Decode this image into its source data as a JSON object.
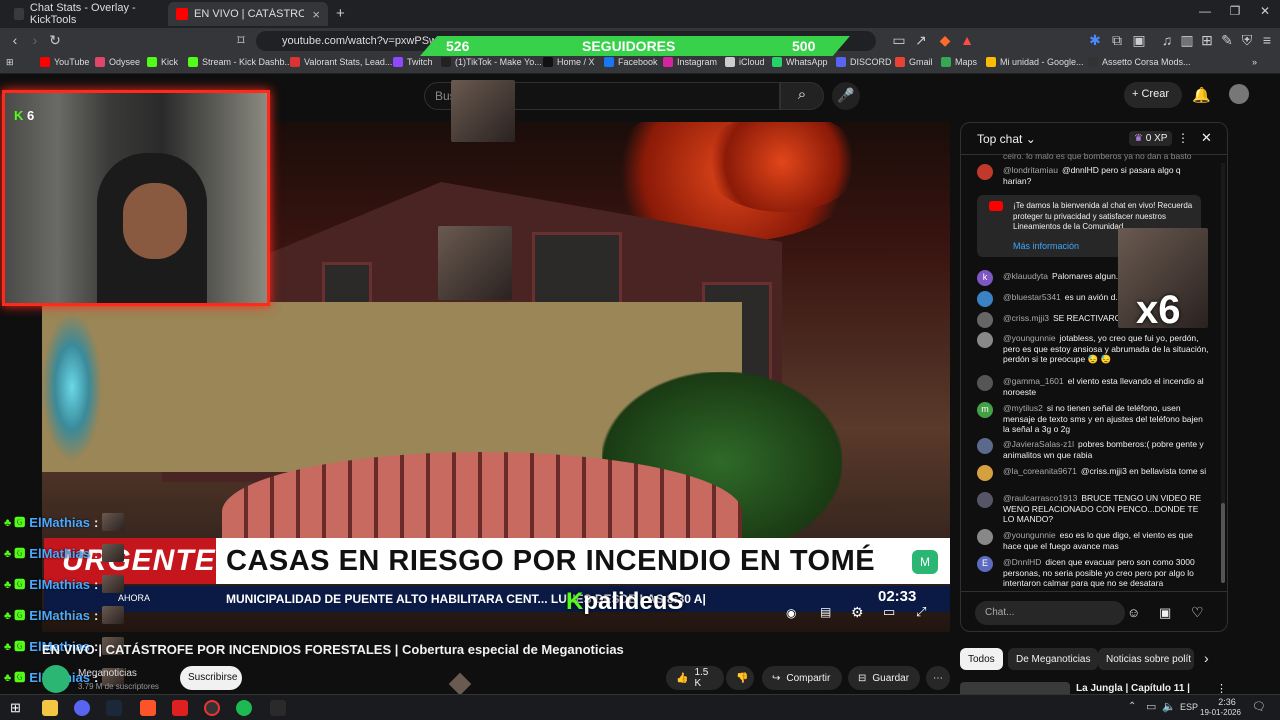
{
  "browser": {
    "tabs": [
      {
        "label": "Chat Stats - Overlay - KickTools"
      },
      {
        "label": "EN VIVO | CATÁSTROFE POR I"
      }
    ],
    "url": "youtube.com/watch?v=pxwPSwTv-10",
    "bookmarks": [
      "YouTube",
      "Odysee",
      "Kick",
      "Stream - Kick Dashb...",
      "Valorant Stats, Lead...",
      "Twitch",
      "(1)TikTok - Make Yo...",
      "Home / X",
      "Facebook",
      "Instagram",
      "iCloud",
      "WhatsApp",
      "DISCORD",
      "Gmail",
      "Maps",
      "Mi unidad - Google...",
      "Assetto Corsa Mods..."
    ]
  },
  "overlay": {
    "followers_current": "526",
    "followers_label": "SEGUIDORES",
    "followers_goal": "500",
    "webcam_badge": "6",
    "chat_user": "ElMathias",
    "chat_sep": ":",
    "x6": "x6",
    "kick_user": "palideuS"
  },
  "youtube": {
    "search_placeholder": "Busca",
    "create_label": "Crear",
    "news": {
      "urgente": "URGENTE",
      "headline": "CASAS EN RIESGO POR INCENDIO EN TOMÉ",
      "ticker": "MUNICIPALIDAD DE PUENTE ALTO HABILITARA CENT... LUNES DESDE LAS 8:30 A|",
      "ahora": "AHORA",
      "clock": "02:33"
    },
    "video_title": "EN VIVO | CATÁSTROFE POR INCENDIOS FORESTALES | Cobertura especial de Meganoticias",
    "channel": "Meganoticias",
    "subscribers": "3.79 M de suscriptores",
    "subscribe_label": "Suscribirse",
    "likes": "1.5 K",
    "share_label": "Compartir",
    "save_label": "Guardar",
    "chips": [
      "Todos",
      "De Meganoticias",
      "Noticias sobre polít"
    ],
    "rec_title": "La Jungla | Capítulo 11 |"
  },
  "chat": {
    "header": "Top chat",
    "xp": "0 XP",
    "top_cut": "ceiro. lo malo es que bomberos ya no dan a basto",
    "welcome": "¡Te damos la bienvenida al chat en vivo! Recuerda proteger tu privacidad y satisfacer nuestros Lineamientos de la Comunidad.",
    "welcome_more": "Más información",
    "messages": [
      {
        "user": "@londritamiau",
        "text": "@dnnlHD pero si pasara algo q harian?",
        "color": "#c0392b",
        "initial": ""
      },
      {
        "user": "@klauudyta",
        "text": "Palomares algun...",
        "color": "#7e57c2",
        "initial": "k"
      },
      {
        "user": "@bluestar5341",
        "text": "es un avión d...",
        "color": "#3b82c4",
        "initial": ""
      },
      {
        "user": "@criss.mjji3",
        "text": "SE REACTIVARON LOS ...",
        "color": "#666",
        "initial": ""
      },
      {
        "user": "@youngunnie",
        "text": "jotabless, yo creo que fui yo, perdón, pero es que estoy ansiosa y abrumada de la situación, perdón si te preocupe 😓 😓",
        "color": "#888",
        "initial": ""
      },
      {
        "user": "@gamma_1601",
        "text": "el viento esta llevando el incendio al noroeste",
        "color": "#555",
        "initial": ""
      },
      {
        "user": "@mytilus2",
        "text": "si no tienen señal de teléfono, usen mensaje de texto sms y en ajustes del teléfono bajen la señal a 3g o 2g",
        "color": "#43a047",
        "initial": "m"
      },
      {
        "user": "@JavieraSalas-z1l",
        "text": "pobres bomberos:( pobre gente y animalitos wn que rabia",
        "color": "#5a6a8a",
        "initial": ""
      },
      {
        "user": "@la_coreanita9671",
        "text": "@criss.mjji3 en bellavista tome si",
        "color": "#d4a040",
        "initial": ""
      },
      {
        "user": "@raulcarrasco1913",
        "text": "BRUCE TENGO UN VIDEO RE WENO RELACIONADO CON PENCO...DONDE TE LO MANDO?",
        "color": "#556",
        "initial": ""
      },
      {
        "user": "@youngunnie",
        "text": "eso es lo que digo, el viento es que hace que el fuego avance mas",
        "color": "#888",
        "initial": ""
      },
      {
        "user": "@DnnlHD",
        "text": "dicen que evacuar pero son como 3000 personas, no seria posible yo creo pero por algo lo intentaron calmar para que no se desatara",
        "color": "#5c6bc0",
        "initial": "E"
      }
    ],
    "input_placeholder": "Chat..."
  },
  "taskbar": {
    "lang": "ESP",
    "time": "2:36",
    "date": "19-01-2026"
  }
}
